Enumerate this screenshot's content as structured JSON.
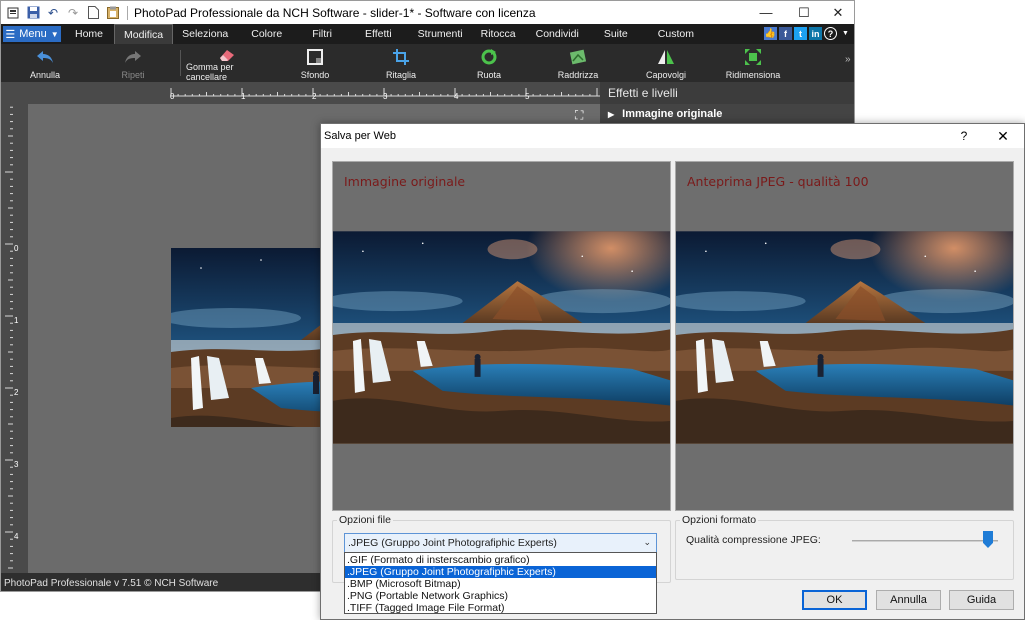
{
  "main_window": {
    "title": "PhotoPad Professionale da NCH Software - slider-1* - Software con licenza",
    "menu_button": "Menu",
    "tabs": [
      "Home",
      "Modifica",
      "Seleziona",
      "Colore",
      "Filtri",
      "Effetti",
      "Strumenti",
      "Ritocca",
      "Condividi",
      "Suite",
      "Custom"
    ],
    "active_tab": "Modifica",
    "toolbar": {
      "undo": "Annulla",
      "redo": "Ripeti",
      "eraser": "Gomma per cancellare",
      "background": "Sfondo",
      "crop": "Ritaglia",
      "rotate": "Ruota",
      "straighten": "Raddrizza",
      "flip": "Capovolgi",
      "resize": "Ridimensiona"
    },
    "ruler_top_labels": [
      "0",
      "1",
      "2",
      "3",
      "4",
      "5"
    ],
    "ruler_left_labels": [
      "0",
      "1",
      "2",
      "3",
      "4"
    ],
    "side_panel": {
      "header": "Effetti e livelli",
      "item": "Immagine originale"
    },
    "status": "PhotoPad Professionale v 7.51 © NCH Software"
  },
  "dialog": {
    "title": "Salva per Web",
    "help_button": "?",
    "original_label": "Immagine originale",
    "preview_label": "Anteprima JPEG - qualità 100",
    "file_options": {
      "label": "Opzioni file",
      "selected": ".JPEG (Gruppo Joint Photografiphic Experts)",
      "options": [
        ".GIF (Formato di insterscambio grafico)",
        ".JPEG (Gruppo Joint Photografiphic Experts)",
        ".BMP (Microsoft Bitmap)",
        ".PNG (Portable Network Graphics)",
        ".TIFF (Tagged Image File Format)"
      ]
    },
    "format_options": {
      "label": "Opzioni formato",
      "quality_label": "Qualità compressione JPEG:",
      "quality_value": 100
    },
    "buttons": {
      "ok": "OK",
      "cancel": "Annulla",
      "help": "Guida"
    }
  }
}
